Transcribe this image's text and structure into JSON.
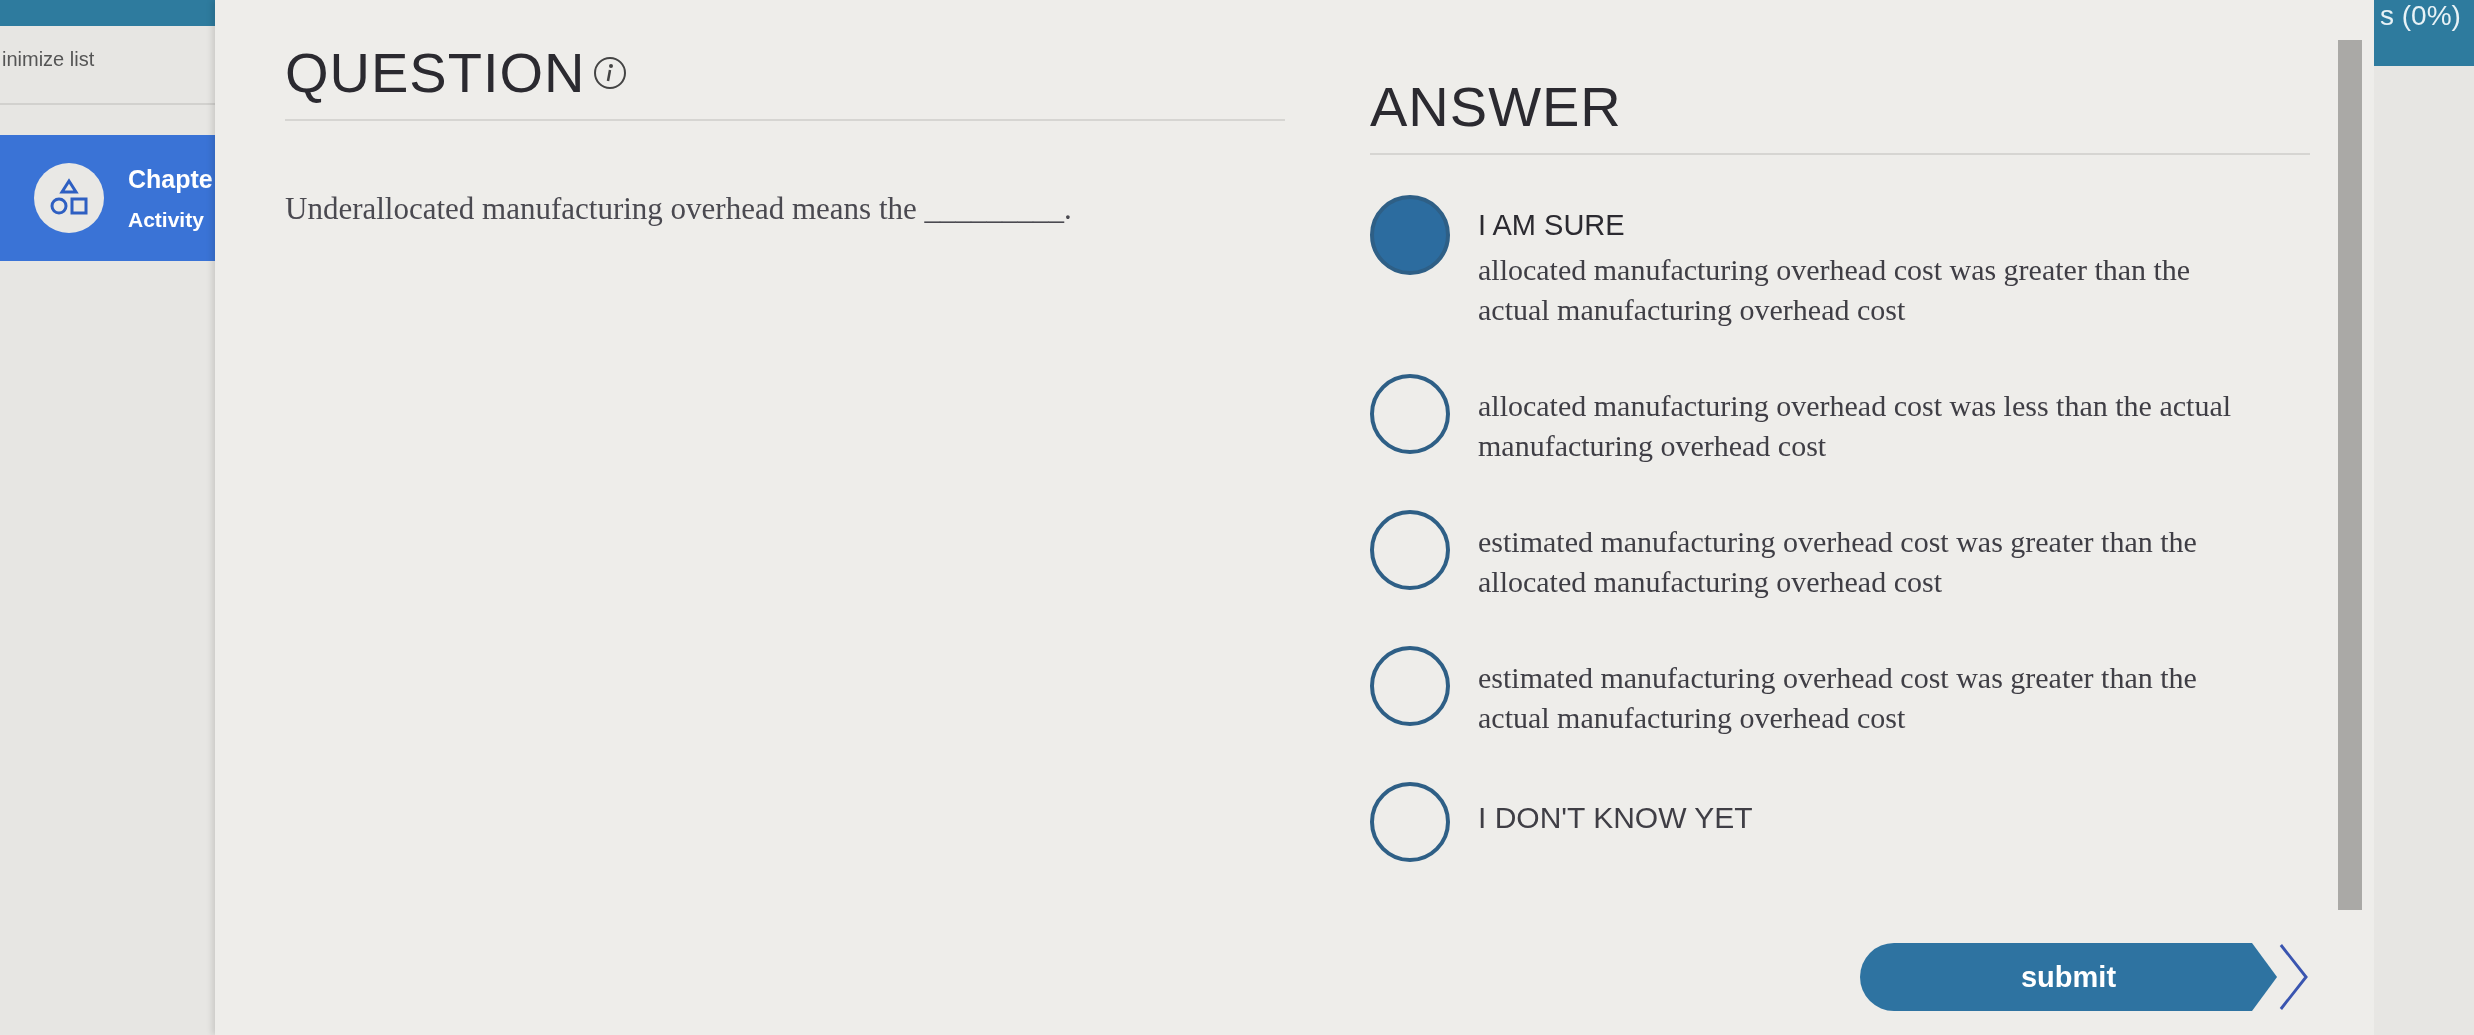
{
  "sidebar": {
    "minimize_label": "inimize list",
    "items": [
      {
        "title": "Chapte",
        "subtitle": "Activity",
        "selected": true
      }
    ]
  },
  "progress": {
    "label": "s (0%)"
  },
  "question": {
    "heading": "QUESTION",
    "prompt": "Underallocated manufacturing overhead means the _________."
  },
  "answer": {
    "heading": "ANSWER",
    "options": [
      {
        "kind": "choice",
        "confidence": "I AM SURE",
        "text": "allocated manufacturing overhead cost was greater than the actual manufacturing overhead cost",
        "selected": true
      },
      {
        "kind": "choice",
        "text": "allocated manufacturing overhead cost was less than the actual manufacturing overhead cost",
        "selected": false
      },
      {
        "kind": "choice",
        "text": "estimated manufacturing overhead cost was greater than the allocated manufacturing overhead cost",
        "selected": false
      },
      {
        "kind": "choice",
        "text": "estimated manufacturing overhead cost was greater than the actual manufacturing overhead cost",
        "selected": false
      },
      {
        "kind": "unsure",
        "text": "I DON'T KNOW YET",
        "selected": false
      }
    ]
  },
  "submit": {
    "label": "submit"
  }
}
